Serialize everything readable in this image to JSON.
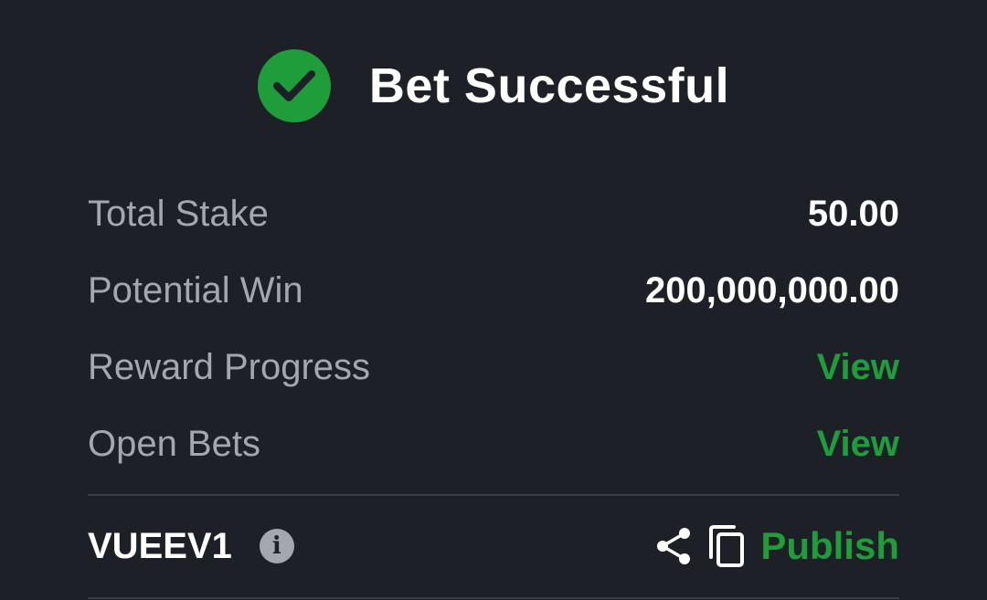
{
  "header": {
    "title": "Bet Successful",
    "icon": "check-circle-icon",
    "accent": "#1f9d3a"
  },
  "summary": {
    "rows": [
      {
        "label": "Total Stake",
        "value": "50.00",
        "kind": "value"
      },
      {
        "label": "Potential Win",
        "value": "200,000,000.00",
        "kind": "value"
      },
      {
        "label": "Reward Progress",
        "value": "View",
        "kind": "link"
      },
      {
        "label": "Open Bets",
        "value": "View",
        "kind": "link"
      }
    ]
  },
  "footer": {
    "booking_code": "VUEEV1",
    "info_icon": "info-icon",
    "info_glyph": "i",
    "share_icon": "share-icon",
    "copy_icon": "copy-icon",
    "publish_label": "Publish"
  },
  "colors": {
    "background": "#1e2027",
    "label": "#a4a7b0",
    "value": "#ffffff",
    "link": "#1f9d3a",
    "divider": "#3a3d45"
  }
}
